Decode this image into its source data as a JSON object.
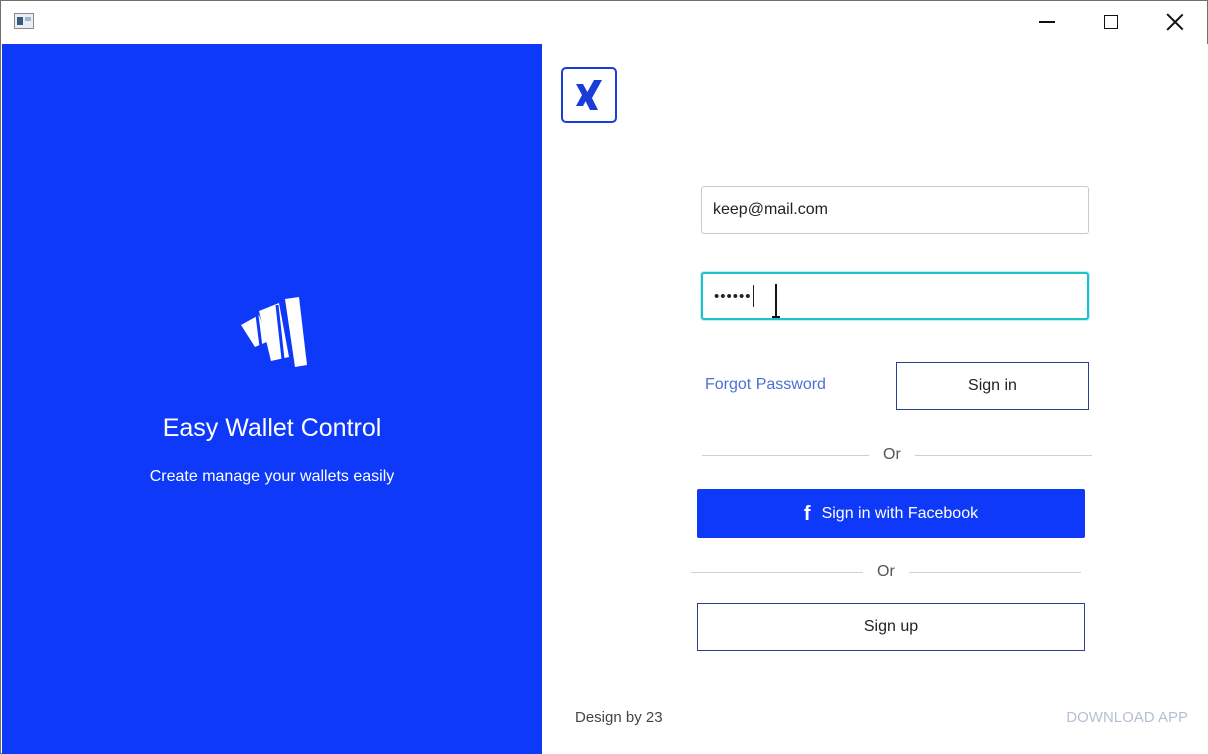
{
  "window": {
    "controls": {
      "minimize_icon": "minimize-icon",
      "maximize_icon": "maximize-icon",
      "close_icon": "close-icon"
    }
  },
  "brand": {
    "title": "Easy Wallet Control",
    "subtitle": "Create manage your wallets easily",
    "panel_color": "#0e39f8"
  },
  "login": {
    "email_value": "keep@mail.com",
    "password_mask": "••••••",
    "forgot_label": "Forgot Password",
    "signin_label": "Sign in",
    "or_label": "Or",
    "facebook_label": "Sign in with Facebook",
    "facebook_icon": "f",
    "signup_label": "Sign up",
    "focus_color": "#1fbfcf"
  },
  "footer": {
    "credit": "Design by 23",
    "download_label": "DOWNLOAD APP"
  }
}
